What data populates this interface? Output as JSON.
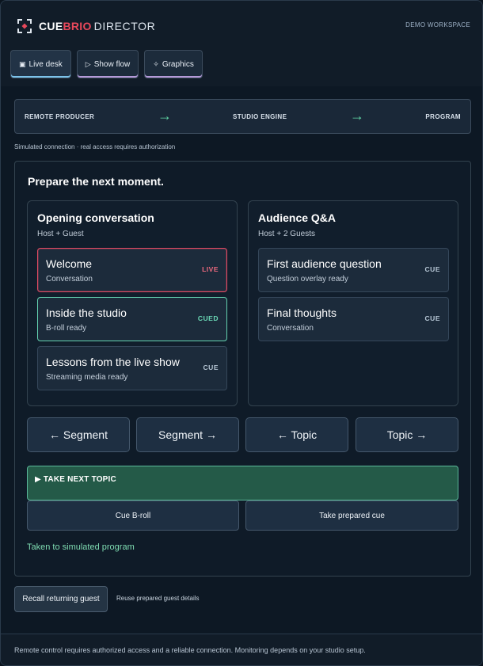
{
  "brand": {
    "name_prefix": "CUE",
    "name_accent": "BRIO",
    "name_suffix": "DIRECTOR",
    "icon": "crosshair-logo-icon",
    "accent_color": "#e8485b"
  },
  "workspace_label": "DEMO WORKSPACE",
  "tabs": [
    {
      "icon": "▣",
      "label": "Live desk",
      "active": true
    },
    {
      "icon": "▷",
      "label": "Show flow",
      "active": false
    },
    {
      "icon": "✧",
      "label": "Graphics",
      "active": false
    }
  ],
  "pipeline": {
    "stages": [
      "REMOTE PRODUCER",
      "STUDIO ENGINE",
      "PROGRAM"
    ],
    "arrow": "→"
  },
  "connection_note": "Simulated connection · real access requires authorization",
  "main": {
    "title": "Prepare the next moment.",
    "segments": [
      {
        "title": "Opening conversation",
        "subtitle": "Host + Guest",
        "items": [
          {
            "title": "Welcome",
            "subtitle": "Conversation",
            "status": "LIVE"
          },
          {
            "title": "Inside the studio",
            "subtitle": "B-roll ready",
            "status": "CUED"
          },
          {
            "title": "Lessons from the live show",
            "subtitle": "Streaming media ready",
            "status": "CUE"
          }
        ]
      },
      {
        "title": "Audience Q&A",
        "subtitle": "Host + 2 Guests",
        "items": [
          {
            "title": "First audience question",
            "subtitle": "Question overlay ready",
            "status": "CUE"
          },
          {
            "title": "Final thoughts",
            "subtitle": "Conversation",
            "status": "CUE"
          }
        ]
      }
    ],
    "nav_buttons": [
      "← Segment",
      "Segment →",
      "← Topic",
      "Topic →"
    ],
    "take_next_label": "▶ TAKE NEXT TOPIC",
    "cue_broll_label": "Cue B-roll",
    "take_prepared_label": "Take prepared cue",
    "status_message": "Taken to simulated program"
  },
  "recall": {
    "button_label": "Recall returning guest",
    "note": "Reuse prepared guest details"
  },
  "footer": "Remote control requires authorized access and a reliable connection. Monitoring depends on your studio setup.",
  "colors": {
    "live": "#e14a63",
    "cued": "#64d2b0",
    "take": "#245a48",
    "arrow": "#5fd3a3"
  }
}
